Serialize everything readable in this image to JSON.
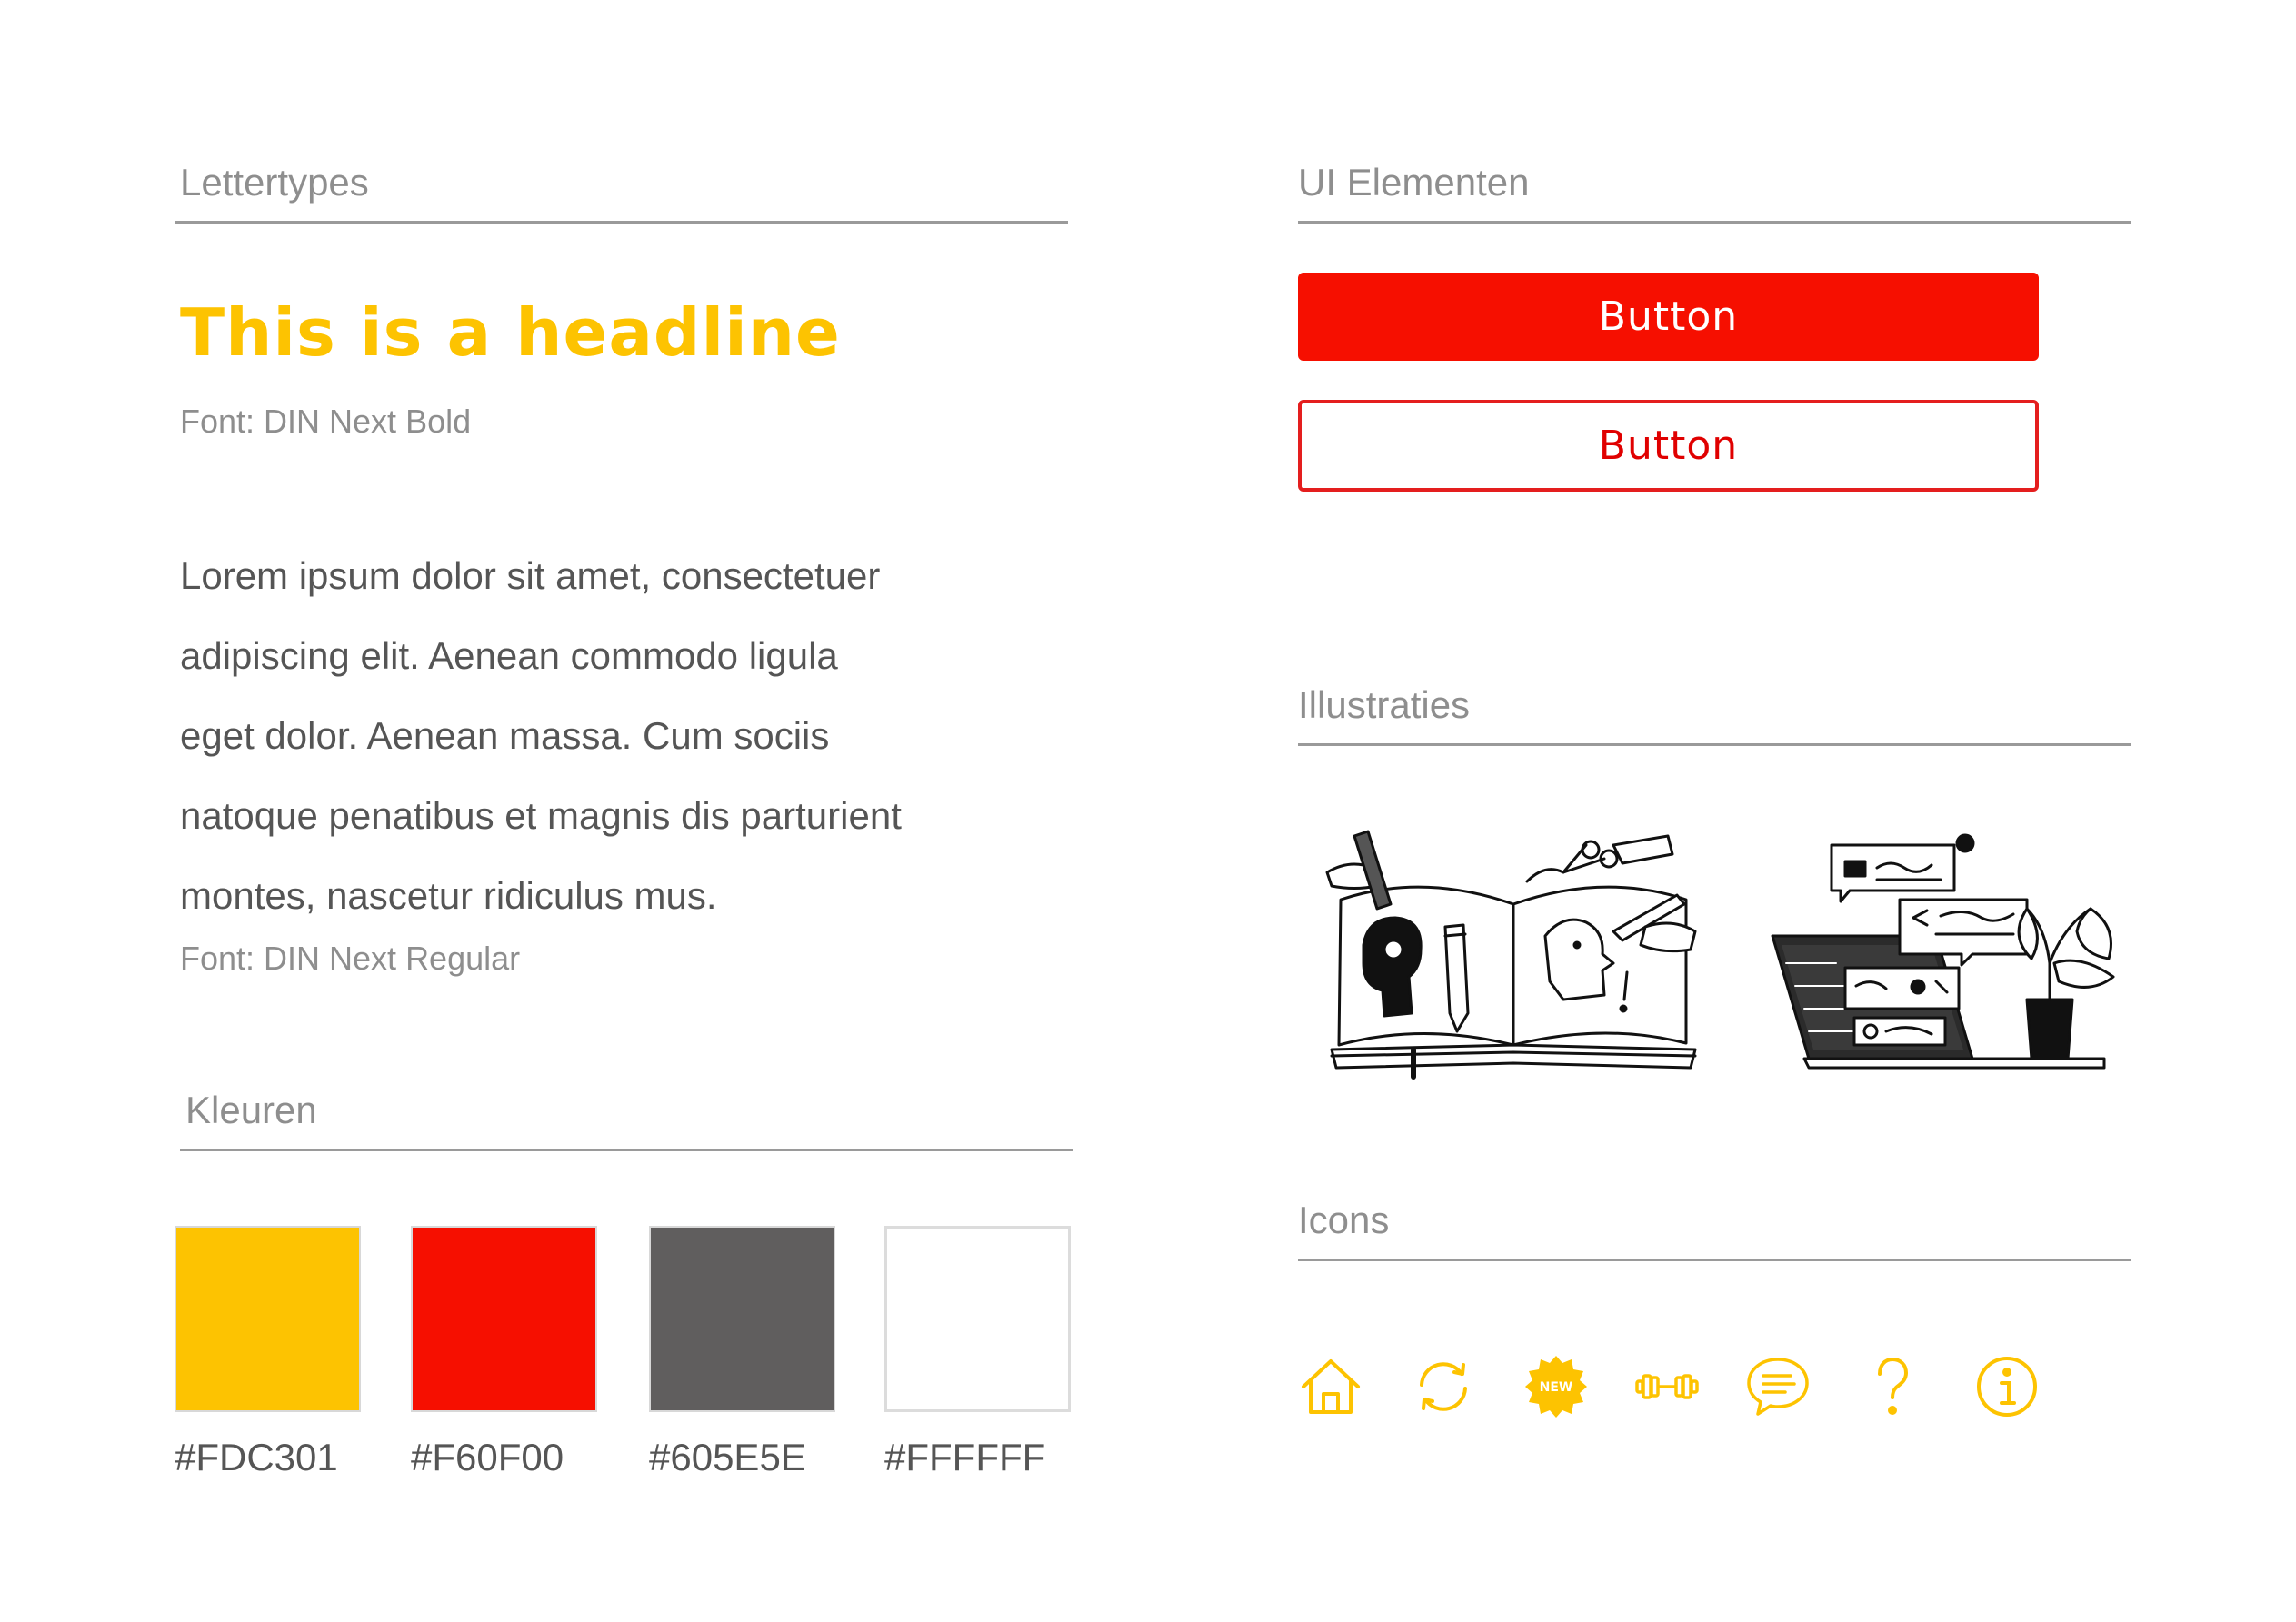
{
  "sections": {
    "fonts": "Lettertypes",
    "colors": "Kleuren",
    "ui": "UI Elementen",
    "illustrations": "Illustraties",
    "icons": "Icons"
  },
  "typography": {
    "headline": "This is a headline",
    "headline_font": "Font: DIN Next Bold",
    "body_lines": [
      "Lorem ipsum dolor sit amet, consectetuer",
      "adipiscing elit. Aenean commodo ligula",
      "eget dolor. Aenean massa. Cum sociis",
      "natoque penatibus et magnis dis parturient",
      "montes, nascetur ridiculus mus."
    ],
    "body_font": "Font: DIN Next Regular"
  },
  "colors": {
    "swatches": [
      {
        "hex": "#FDC301",
        "label": "#FDC301"
      },
      {
        "hex": "#F60F00",
        "label": "#F60F00"
      },
      {
        "hex": "#605E5E",
        "label": "#605E5E"
      },
      {
        "hex": "#FFFFFF",
        "label": "#FFFFFF"
      }
    ],
    "accent": "#FDC301",
    "primary": "#F60F00"
  },
  "ui": {
    "primary_button": "Button",
    "secondary_button": "Button"
  },
  "icons": {
    "items": [
      "home-icon",
      "refresh-icon",
      "new-badge-icon",
      "dumbbell-icon",
      "chat-icon",
      "question-icon",
      "info-icon"
    ],
    "new_badge_text": "NEW"
  }
}
